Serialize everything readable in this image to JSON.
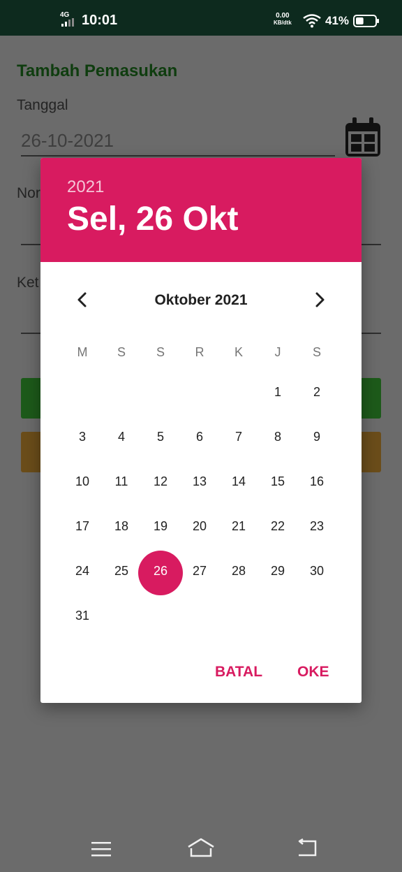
{
  "status_bar": {
    "network": "4G",
    "time": "10:01",
    "speed_value": "0.00",
    "speed_unit": "KB/dtk",
    "battery_pct": "41%",
    "battery_level": 0.41
  },
  "form": {
    "title": "Tambah Pemasukan",
    "date_label": "Tanggal",
    "date_value": "26-10-2021",
    "field2_label_partial": "Nor",
    "field3_label_partial": "Ket"
  },
  "dialog": {
    "year": "2021",
    "selected_date": "Sel, 26 Okt",
    "month_title": "Oktober 2021",
    "weekdays": [
      "M",
      "S",
      "S",
      "R",
      "K",
      "J",
      "S"
    ],
    "weeks": [
      [
        "",
        "",
        "",
        "",
        "",
        "1",
        "2"
      ],
      [
        "3",
        "4",
        "5",
        "6",
        "7",
        "8",
        "9"
      ],
      [
        "10",
        "11",
        "12",
        "13",
        "14",
        "15",
        "16"
      ],
      [
        "17",
        "18",
        "19",
        "20",
        "21",
        "22",
        "23"
      ],
      [
        "24",
        "25",
        "26",
        "27",
        "28",
        "29",
        "30"
      ],
      [
        "31",
        "",
        "",
        "",
        "",
        "",
        ""
      ]
    ],
    "selected_day": "26",
    "cancel_label": "BATAL",
    "ok_label": "OKE"
  },
  "colors": {
    "accent": "#d81b60",
    "title_green": "#0f3d0f",
    "status_bar": "#0d2a1e"
  },
  "icons": {
    "prev": "chevron-left-icon",
    "next": "chevron-right-icon",
    "calendar": "calendar-icon"
  }
}
